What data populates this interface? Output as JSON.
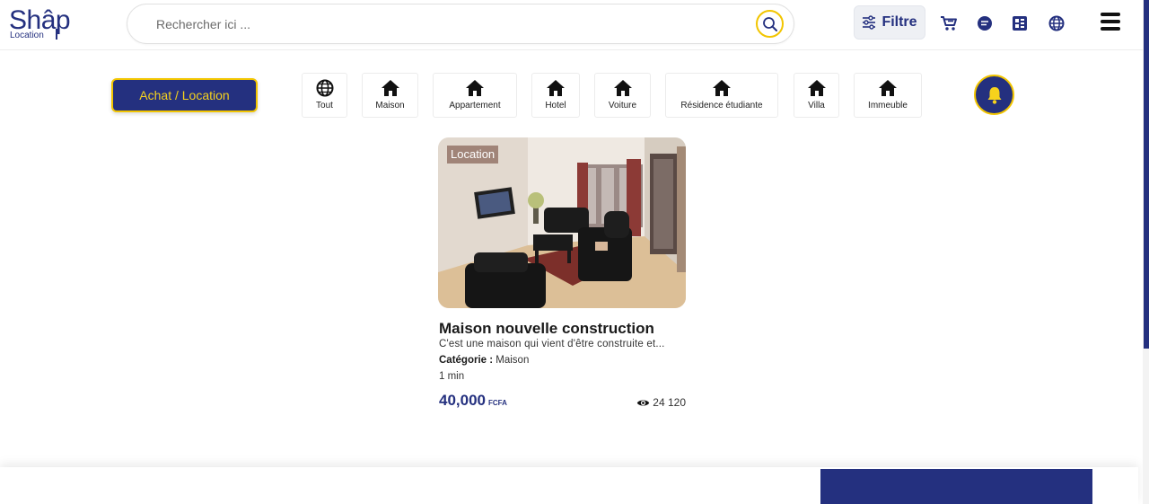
{
  "header": {
    "logo_main": "Shâp",
    "logo_sub": "Location",
    "search_placeholder": "Rechercher ici ...",
    "filter_label": "Filtre",
    "icons": [
      "cart-icon",
      "chat-icon",
      "layout-icon",
      "globe-icon",
      "menu-icon"
    ]
  },
  "toolbar": {
    "mode_button": "Achat / Location",
    "categories": [
      {
        "label": "Tout",
        "icon": "globe-icon"
      },
      {
        "label": "Maison",
        "icon": "home-icon"
      },
      {
        "label": "Appartement",
        "icon": "home-icon"
      },
      {
        "label": "Hotel",
        "icon": "home-icon"
      },
      {
        "label": "Voiture",
        "icon": "home-icon"
      },
      {
        "label": "Résidence étudiante",
        "icon": "home-icon"
      },
      {
        "label": "Villa",
        "icon": "home-icon"
      },
      {
        "label": "Immeuble",
        "icon": "home-icon"
      }
    ],
    "bell_icon": "bell-icon"
  },
  "listing": {
    "badge": "Location",
    "title": "Maison nouvelle construction",
    "description": "C'est une maison qui vient d'être construite et...",
    "category_label": "Catégorie :",
    "category_value": "Maison",
    "time": "1 min",
    "price": "40,000",
    "currency": "FCFA",
    "views": "24 120"
  },
  "colors": {
    "brand_blue": "#24307f",
    "accent_yellow": "#f2c500"
  }
}
